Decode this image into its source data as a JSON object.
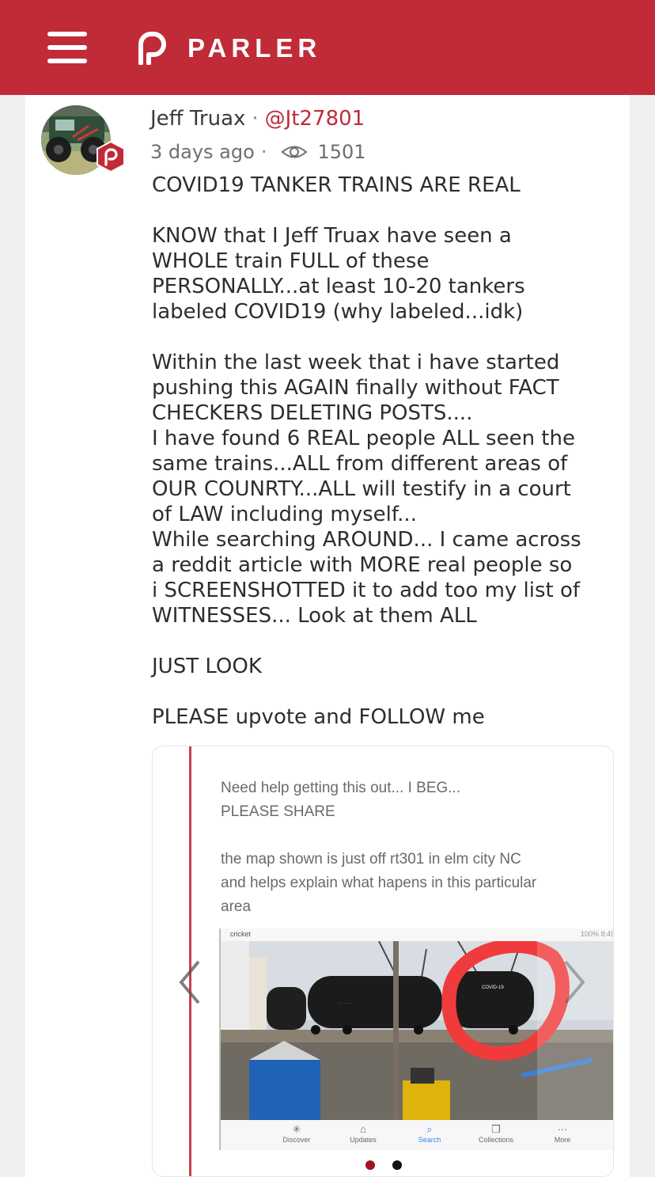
{
  "header": {
    "brand": "PARLER",
    "menu_icon": "hamburger-menu-icon",
    "logo_icon": "parler-p-logo-icon",
    "brand_color": "#c12a37"
  },
  "post": {
    "author": {
      "name": "Jeff Truax",
      "separator": "·",
      "handle": "@Jt27801"
    },
    "meta": {
      "time": "3 days ago",
      "separator": "·",
      "views_icon": "eye-icon",
      "views": "1501"
    },
    "body_lines": [
      "COVID19 TANKER TRAINS ARE REAL",
      "",
      "KNOW that I Jeff Truax have seen a",
      "WHOLE train FULL of these",
      "PERSONALLY...at least 10-20 tankers",
      "labeled COVID19 (why labeled...idk)",
      "",
      "Within the last week that i have started",
      "pushing this AGAIN finally without FACT",
      "CHECKERS DELETING POSTS....",
      "I have found 6 REAL people ALL seen the",
      "same trains...ALL from different areas of",
      "OUR COUNRTY...ALL will testify in a court",
      "of LAW including myself...",
      "While searching AROUND... I came across",
      "a reddit article with MORE real people so",
      "i SCREENSHOTTED it to add too my list of",
      "WITNESSES... Look at them ALL",
      "",
      "JUST LOOK",
      "",
      "PLEASE upvote and FOLLOW me"
    ],
    "media": {
      "screenshot_text": [
        "Need help getting this out... I BEG...",
        "PLEASE SHARE",
        "",
        "the map shown is just off rt301 in elm city NC",
        "and helps explain what hapens in this particular",
        "area"
      ],
      "status_bar": {
        "carrier": "cricket",
        "right": "100% 8:49"
      },
      "tanker_label": "COVID-19",
      "nav_items": [
        {
          "label": "Discover",
          "icon": "✳"
        },
        {
          "label": "Updates",
          "icon": "⌂"
        },
        {
          "label": "Search",
          "icon": "⌕"
        },
        {
          "label": "Collections",
          "icon": "❐"
        },
        {
          "label": "More",
          "icon": "···"
        }
      ],
      "carousel_dots": 2,
      "active_dot": 1
    }
  }
}
